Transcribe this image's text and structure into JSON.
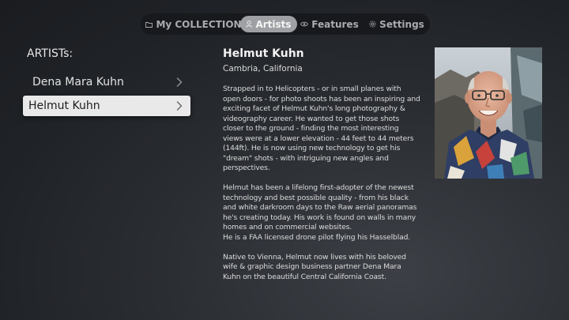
{
  "nav": {
    "tabs": [
      {
        "label": "My COLLECTION",
        "icon": "folder-icon",
        "active": false
      },
      {
        "label": "Artists",
        "icon": "person-icon",
        "active": true
      },
      {
        "label": "Features",
        "icon": "eye-icon",
        "active": false
      },
      {
        "label": "Settings",
        "icon": "gear-icon",
        "active": false
      }
    ]
  },
  "artist_list": {
    "heading": "ARTISTs:",
    "items": [
      {
        "name": "Dena Mara Kuhn",
        "selected": false
      },
      {
        "name": "Helmut Kuhn",
        "selected": true
      }
    ]
  },
  "detail": {
    "name": "Helmut Kuhn",
    "location": "Cambria, California",
    "bio": [
      "Strapped in to Helicopters - or in small planes with open doors - for photo shoots has been an inspiring and exciting facet of Helmut Kuhn's long photography & videography career. He wanted to get those shots closer to the ground - finding the most interesting views were at a lower elevation - 44 feet to 44 meters (144ft). He is now using new technology to get his \"dream\" shots - with intriguing new angles and perspectives.",
      "Helmut has been a lifelong first-adopter of the newest technology and best possible quality - from his black and white darkroom days to the Raw aerial panoramas he's creating today. His work is found on walls in many homes and on commercial websites.",
      "He is a FAA licensed drone pilot flying his Hasselblad.",
      "Native to Vienna,  Helmut now lives with his beloved wife & graphic design business partner Dena Mara Kuhn on the beautiful Central California Coast."
    ]
  },
  "colors": {
    "background": "#2b2e33",
    "tabbar": "#17191c",
    "active_tab": "#9ea0a3",
    "selected_row": "#e9e9ea"
  }
}
